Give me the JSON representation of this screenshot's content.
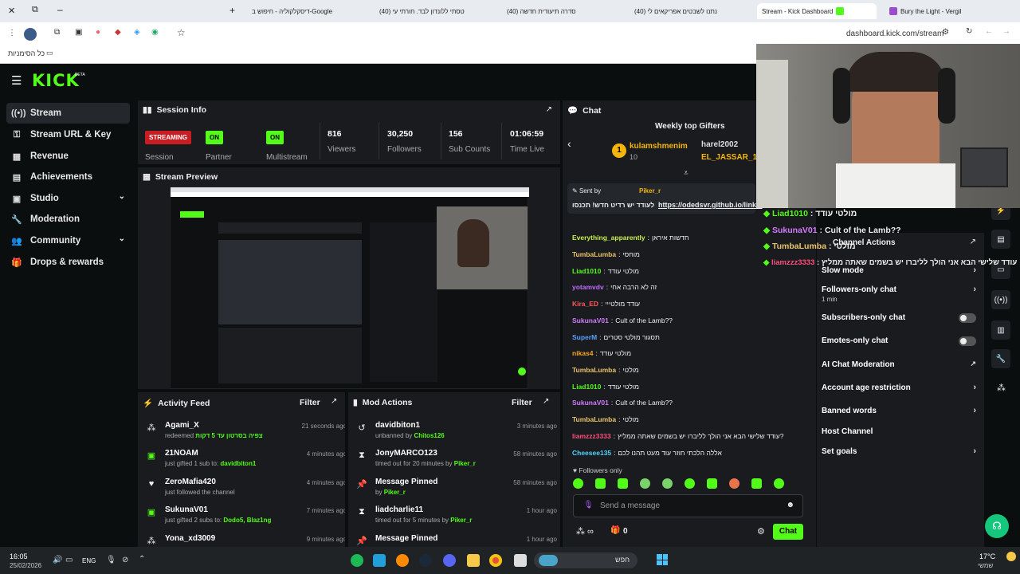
{
  "browser": {
    "tabs": [
      {
        "title": "Bury the Light - Vergil"
      },
      {
        "title": "Stream - Kick Dashboard"
      },
      {
        "title": "(40) נתנו לשבטים אפריקאים לי"
      },
      {
        "title": "(40) סדרה תיעודית חדשה"
      },
      {
        "title": "(40) טסתי ללונדון לבד. חורתי עי"
      },
      {
        "title": "דיסקלקוליה - חיפוש ב-Google"
      }
    ],
    "url": "dashboard.kick.com/stream",
    "bookmarks_label": "כל הסימניות"
  },
  "kick": {
    "logo": "KICK",
    "beta": "BETA",
    "accent": "#53fc18",
    "nav": [
      {
        "label": "Stream",
        "icon": "stream-icon"
      },
      {
        "label": "Stream URL & Key",
        "icon": "key-icon"
      },
      {
        "label": "Revenue",
        "icon": "dollar-icon"
      },
      {
        "label": "Achievements",
        "icon": "trophy-icon"
      },
      {
        "label": "Studio",
        "icon": "studio-icon"
      },
      {
        "label": "Moderation",
        "icon": "wrench-icon"
      },
      {
        "label": "Community",
        "icon": "people-icon"
      },
      {
        "label": "Drops & rewards",
        "icon": "gift-icon"
      }
    ]
  },
  "session": {
    "title": "Session Info",
    "streaming_badge": "STREAMING",
    "streaming_label": "Session",
    "partner_badge": "ON",
    "partner_label": "Partner Income",
    "multistream_badge": "ON",
    "multistream_label": "Multistream",
    "viewers": "816",
    "viewers_label": "Viewers",
    "followers": "30,250",
    "followers_label": "Followers",
    "subs": "156",
    "subs_label": "Sub Counts",
    "time": "01:06:59",
    "time_label": "Time Live"
  },
  "preview": {
    "title": "Stream Preview"
  },
  "activity": {
    "title": "Activity Feed",
    "filter": "Filter",
    "items": [
      {
        "name": "Agami_X",
        "action": "redeemed",
        "detail": "צפיה בסרטון עד 5 דקות",
        "time": "21 seconds ago",
        "icon": "redeem-icon"
      },
      {
        "name": "21NOAM",
        "action": "just gifted 1 sub to:",
        "detail": "davidbiton1",
        "time": "4 minutes ago",
        "icon": "gift-icon"
      },
      {
        "name": "ZeroMafia420",
        "action": "just followed the channel",
        "detail": "",
        "time": "4 minutes ago",
        "icon": "heart-icon"
      },
      {
        "name": "SukunaV01",
        "action": "just gifted 2 subs to:",
        "detail": "Dodo5, Blaz1ng",
        "time": "7 minutes ago",
        "icon": "gift-icon"
      },
      {
        "name": "Yona_xd3009",
        "action": "",
        "detail": "",
        "time": "9 minutes ago",
        "icon": "redeem-icon"
      }
    ]
  },
  "mod": {
    "title": "Mod Actions",
    "filter": "Filter",
    "items": [
      {
        "name": "davidbiton1",
        "action": "unbanned by",
        "by": "Chitos126",
        "time": "3 minutes ago",
        "icon": "unban-icon"
      },
      {
        "name": "JonyMARCO123",
        "action": "timed out for 20 minutes by",
        "by": "Piker_r",
        "time": "58 minutes ago",
        "icon": "hourglass-icon"
      },
      {
        "name": "Message Pinned",
        "action": "by",
        "by": "Piker_r",
        "time": "58 minutes ago",
        "icon": "pin-icon"
      },
      {
        "name": "liadcharlie11",
        "action": "timed out for 5 minutes by",
        "by": "Piker_r",
        "time": "1 hour ago",
        "icon": "hourglass-icon"
      },
      {
        "name": "Message Pinned",
        "action": "",
        "by": "",
        "time": "1 hour ago",
        "icon": "pin-icon"
      }
    ]
  },
  "chat": {
    "title": "Chat",
    "gifters_title": "Weekly top Gifters",
    "gifters": [
      {
        "rank": "1",
        "name": "kulamshmenim",
        "count": "10"
      },
      {
        "name": "harel2002"
      },
      {
        "name": "EL_JASSAR_1"
      }
    ],
    "pinned_label": "Sent by",
    "pinned_user": "Piker_r",
    "pinned_text": "לעודד יש רדיט חדש! תכנסו",
    "pinned_link": "https://odedsvr.github.io/links/",
    "messages": [
      {
        "user": "Everything_apparently",
        "text": "חדשות איראן",
        "color": "#c8f04a"
      },
      {
        "user": "TumbaLumba",
        "text": "מוחסי",
        "color": "#e9c46a"
      },
      {
        "user": "Liad1010",
        "text": "מולטי עודד",
        "color": "#53fc18"
      },
      {
        "user": "yotamvdv",
        "text": "זה לא הרבה אחי",
        "color": "#c06bff"
      },
      {
        "user": "Kira_ED",
        "text": "עודד מולטייי",
        "color": "#ff5a5a"
      },
      {
        "user": "SukunaV01",
        "text": "Cult of the Lamb??",
        "color": "#d27bff"
      },
      {
        "user": "SuperM",
        "text": "תסגור מולטי סטרים",
        "color": "#5aa0ff"
      },
      {
        "user": "nikas4",
        "text": "מולטי עודד",
        "color": "#f5a623"
      },
      {
        "user": "TumbaLumba",
        "text": "מולטי",
        "color": "#e9c46a"
      },
      {
        "user": "Liad1010",
        "text": "מולטי עודד",
        "color": "#53fc18"
      },
      {
        "user": "SukunaV01",
        "text": "Cult of the Lamb??",
        "color": "#d27bff"
      },
      {
        "user": "TumbaLumba",
        "text": "מולטי",
        "color": "#e9c46a"
      },
      {
        "user": "liamzzz3333",
        "text": "עודד שלישי הבא אני הולך לליברו יש בשמים שאתה ממליץ?",
        "color": "#ff4f7b"
      },
      {
        "user": "Cheesee135",
        "text": "אללה הלכתי חוזר עוד מעט תהנו לכם",
        "color": "#4fd4ff"
      }
    ],
    "followers_only": "Followers only",
    "placeholder": "Send a message",
    "points": "0",
    "send": "Chat"
  },
  "actions": {
    "title": "Channel Actions",
    "items": [
      {
        "label": "Slow mode",
        "sub": ""
      },
      {
        "label": "Followers-only chat",
        "sub": "1 min"
      },
      {
        "label": "Subscribers-only chat",
        "sub": ""
      },
      {
        "label": "Emotes-only chat",
        "sub": ""
      },
      {
        "label": "AI Chat Moderation",
        "sub": ""
      },
      {
        "label": "Account age restriction",
        "sub": ""
      },
      {
        "label": "Banned words",
        "sub": ""
      },
      {
        "label": "Host Channel",
        "sub": ""
      },
      {
        "label": "Set goals",
        "sub": ""
      }
    ]
  },
  "overlay": {
    "lines": [
      {
        "user": "Liad1010",
        "text": ": מולטי עודד"
      },
      {
        "user": "SukunaV01",
        "text": ": Cult of the Lamb??"
      },
      {
        "user": "TumbaLumba",
        "text": ": מולטי"
      },
      {
        "user": "liamzzz3333",
        "text": ": עודד שלישי הבא אני הולך לליברו יש בשמים שאתה ממליץ"
      }
    ]
  },
  "taskbar": {
    "time": "16:05",
    "date": "25/02/2026",
    "lang": "ENG",
    "search": "חפש",
    "temp": "17°C",
    "weather": "שמשי"
  }
}
